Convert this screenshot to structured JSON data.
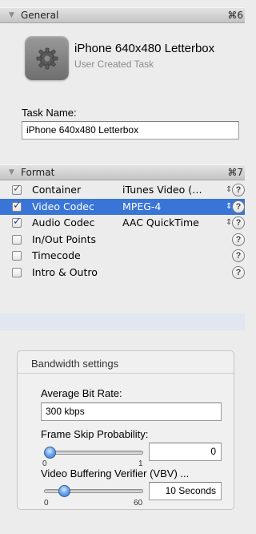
{
  "general": {
    "header": "General",
    "shortcut": "⌘6",
    "task_title": "iPhone 640x480 Letterbox",
    "task_subtitle": "User Created Task",
    "task_name_label": "Task Name:",
    "task_name_value": "iPhone 640x480 Letterbox"
  },
  "format": {
    "header": "Format",
    "shortcut": "⌘7",
    "rows": [
      {
        "name": "Container",
        "value": "iTunes Video (…",
        "checked": true,
        "selected": false,
        "has_stepper": true
      },
      {
        "name": "Video Codec",
        "value": "MPEG-4",
        "checked": true,
        "selected": true,
        "has_stepper": true
      },
      {
        "name": "Audio Codec",
        "value": "AAC QuickTime",
        "checked": true,
        "selected": false,
        "has_stepper": true
      },
      {
        "name": "In/Out Points",
        "value": "",
        "checked": false,
        "selected": false,
        "has_stepper": false
      },
      {
        "name": "Timecode",
        "value": "",
        "checked": false,
        "selected": false,
        "has_stepper": false
      },
      {
        "name": "Intro & Outro",
        "value": "",
        "checked": false,
        "selected": false,
        "has_stepper": false
      }
    ],
    "stepper_glyph": "⇕",
    "help_glyph": "?"
  },
  "bandwidth": {
    "title": "Bandwidth settings",
    "avg_bitrate_label": "Average Bit Rate:",
    "avg_bitrate_value": "300 kbps",
    "frame_skip_label": "Frame Skip Probability:",
    "frame_skip_value": "0",
    "frame_skip_min": "0",
    "frame_skip_max": "1",
    "frame_skip_level": 0.0,
    "vbv_label": "Video Buffering Verifier (VBV) ...",
    "vbv_value": "10 Seconds",
    "vbv_min": "0",
    "vbv_max": "60",
    "vbv_level": 0.167
  },
  "colors": {
    "selection": "#3875d7",
    "empty_row": "#e1e6ef",
    "knob": "#5b9be8"
  }
}
